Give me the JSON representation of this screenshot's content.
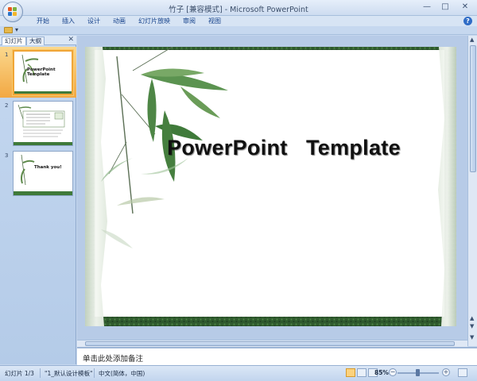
{
  "window": {
    "title": "竹子 [兼容模式] - Microsoft PowerPoint",
    "minimize": "—",
    "maximize": "□",
    "close": "✕"
  },
  "ribbon": {
    "tabs": [
      "开始",
      "插入",
      "设计",
      "动画",
      "幻灯片放映",
      "审阅",
      "视图"
    ],
    "help": "?"
  },
  "toolbar": {
    "more": "▾"
  },
  "pane": {
    "tabs": [
      "幻灯片",
      "大纲"
    ],
    "close": "✕",
    "slides": [
      {
        "num": "1",
        "text": "PowerPoint Template",
        "selected": true
      },
      {
        "num": "2",
        "text": "",
        "selected": false
      },
      {
        "num": "3",
        "text": "Thank you!",
        "selected": false
      }
    ]
  },
  "slide": {
    "title": "PowerPoint   Template"
  },
  "notes": {
    "placeholder": "单击此处添加备注"
  },
  "status": {
    "slide_index": "幻灯片 1/3",
    "theme": "\"1_默认设计模板\"",
    "language": "中文(简体，中国)",
    "zoom": "85%",
    "zoom_out": "−",
    "zoom_in": "+"
  },
  "colors": {
    "selection": "#f2a843",
    "bamboo_green": "#3f7a3a",
    "title_text": "#111111"
  }
}
